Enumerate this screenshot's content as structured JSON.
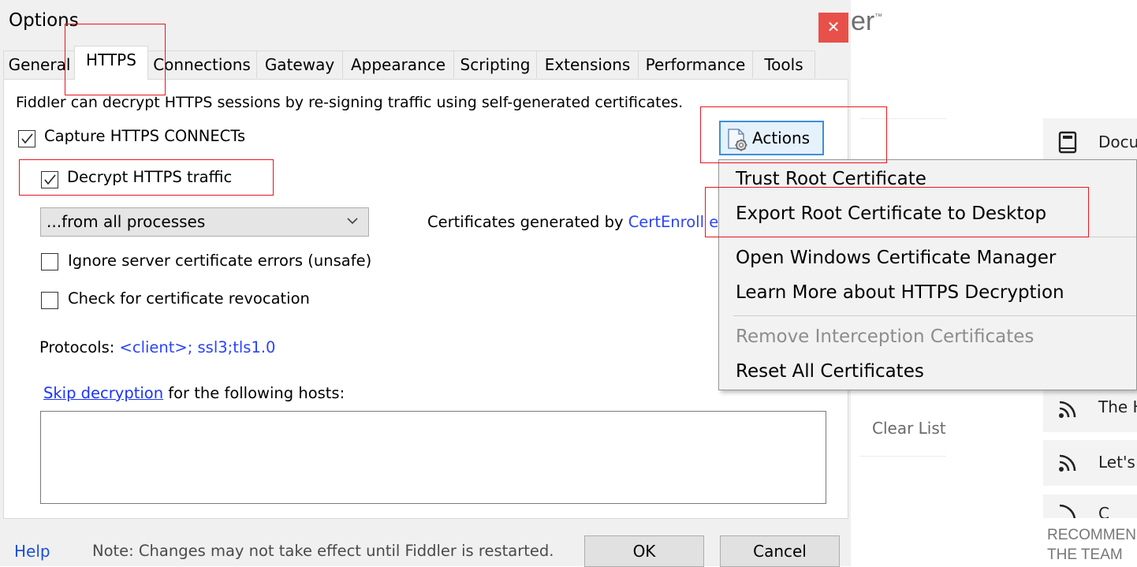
{
  "background": {
    "logo_fragment": "er",
    "logo_mark": "™",
    "clear_list": "Clear List",
    "cards": [
      {
        "icon": "book-icon",
        "label": "Docu"
      },
      {
        "icon": "rss-icon",
        "label": "The H"
      },
      {
        "icon": "rss-icon",
        "label": "Let's"
      },
      {
        "icon": "rss-icon",
        "label": "C"
      }
    ],
    "recommend_line1": "RECOMMEN",
    "recommend_line2": "THE TEAM"
  },
  "dialog": {
    "title": "Options",
    "close_glyph": "✕",
    "tabs": [
      "General",
      "HTTPS",
      "Connections",
      "Gateway",
      "Appearance",
      "Scripting",
      "Extensions",
      "Performance",
      "Tools"
    ],
    "active_tab": "HTTPS",
    "https": {
      "description": "Fiddler can decrypt HTTPS sessions by re-signing traffic using self-generated certificates.",
      "capture_connects": {
        "label": "Capture HTTPS CONNECTs",
        "checked": true
      },
      "decrypt_traffic": {
        "label": "Decrypt HTTPS traffic",
        "checked": true
      },
      "process_filter": "...from all processes",
      "cert_generated_prefix": "Certificates generated by ",
      "cert_generator": "CertEnroll e",
      "ignore_errors": {
        "label": "Ignore server certificate errors (unsafe)",
        "checked": false
      },
      "check_revocation": {
        "label": "Check for certificate revocation",
        "checked": false
      },
      "protocols_label": "Protocols: ",
      "protocols_value": "<client>; ssl3;tls1.0",
      "skip_link": "Skip decryption",
      "skip_rest": " for the following hosts:",
      "hosts_value": "",
      "actions_button": "Actions"
    },
    "footer": {
      "help": "Help",
      "note": "Note: Changes may not take effect until Fiddler is restarted.",
      "ok": "OK",
      "cancel": "Cancel"
    }
  },
  "actions_menu": {
    "items": [
      {
        "label": "Trust Root Certificate",
        "enabled": true
      },
      {
        "label": "Export Root Certificate to Desktop",
        "enabled": true
      },
      {
        "label": "Open Windows Certificate Manager",
        "enabled": true
      },
      {
        "label": "Learn More about HTTPS Decryption",
        "enabled": true
      },
      {
        "label": "Remove Interception Certificates",
        "enabled": false
      },
      {
        "label": "Reset All Certificates",
        "enabled": true
      }
    ]
  },
  "colors": {
    "accent_link": "#2a43ff",
    "annotation_red": "#e8161e",
    "close_red": "#e8504a",
    "actions_border": "#3c8fd8"
  }
}
